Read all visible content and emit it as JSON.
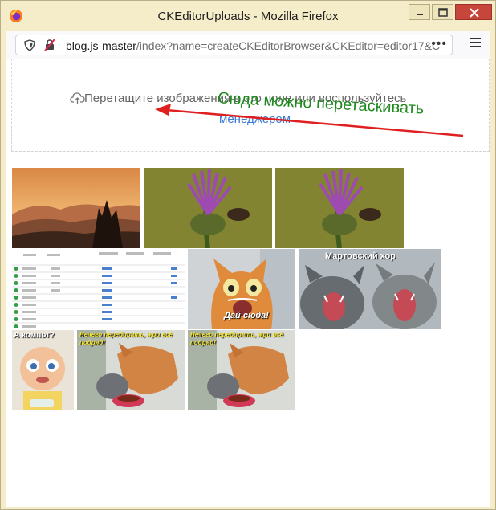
{
  "window": {
    "title": "CKEditorUploads - Mozilla Firefox"
  },
  "urlbar": {
    "host": "blog.js-master",
    "path": "/index?name=createCKEditorBrowser&CKEditor=editor17&C",
    "more_label": "•••"
  },
  "dropzone": {
    "text": "Перетащите изображения в это поле или воспользуйтесь",
    "link": "менеджером"
  },
  "annotation": {
    "text": "Сюда можно перетаскивать",
    "color": "#1e8a1e",
    "arrow_color": "#e02020"
  },
  "thumbnails": [
    {
      "name": "sunset-mountains-image"
    },
    {
      "name": "thistle-flower-image"
    },
    {
      "name": "thistle-flower-image-2"
    },
    {
      "name": "table-screenshot-image"
    },
    {
      "name": "shocked-cat-image",
      "caption": "Дай сюда!"
    },
    {
      "name": "yelling-cats-image",
      "caption": "Мартовский хор"
    },
    {
      "name": "baby-image",
      "caption": "А компот?"
    },
    {
      "name": "cats-eating-image",
      "caption": "Нечего перебирать, жри всё подряд!"
    },
    {
      "name": "cats-eating-image-2",
      "caption": "Нечего перебирать, жри всё подряд!"
    }
  ]
}
